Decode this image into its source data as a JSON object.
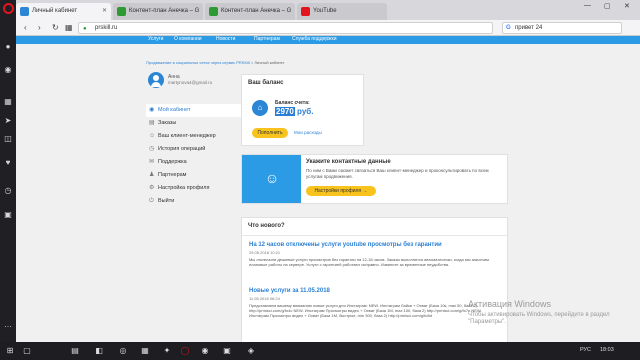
{
  "browser": {
    "tabs": [
      {
        "label": "Личный кабинет",
        "active": true,
        "favicon_color": "#2b86d6"
      },
      {
        "label": "Контент-план Анечка – G",
        "active": false,
        "favicon_color": "#2e9a33"
      },
      {
        "label": "Контент-план Анечка – G",
        "active": false,
        "favicon_color": "#2e9a33"
      },
      {
        "label": "YouTube",
        "active": false,
        "favicon_color": "#e2141d"
      }
    ],
    "url": "prskill.ru",
    "search_value": "привет 24"
  },
  "site_nav": [
    "Услуги",
    "О компании",
    "Новости",
    "Партнерам",
    "Служба поддержки"
  ],
  "breadcrumb": {
    "root": "Продвижение в социальных сетях через сервис PRSKill",
    "current": "Личный кабинет"
  },
  "user": {
    "name": "Анна",
    "email": "martynova4@gmail.ru"
  },
  "menu": [
    {
      "label": "Мой кабинет",
      "icon": "dashboard-icon",
      "glyph": "◉",
      "active": true
    },
    {
      "label": "Заказы",
      "icon": "orders-icon",
      "glyph": "▤",
      "active": false
    },
    {
      "label": "Ваш клиент-менеджер",
      "icon": "manager-icon",
      "glyph": "☺",
      "active": false
    },
    {
      "label": "История операций",
      "icon": "history-icon",
      "glyph": "◷",
      "active": false
    },
    {
      "label": "Поддержка",
      "icon": "support-icon",
      "glyph": "✉",
      "active": false
    },
    {
      "label": "Партнерам",
      "icon": "partners-icon",
      "glyph": "♟",
      "active": false
    },
    {
      "label": "Настройка профиля",
      "icon": "settings-icon",
      "glyph": "⚙",
      "active": false
    },
    {
      "label": "Выйти",
      "icon": "logout-icon",
      "glyph": "⏻",
      "active": false
    }
  ],
  "balance": {
    "title": "Ваш баланс",
    "label": "Баланс счета:",
    "value": "2970",
    "currency": "руб.",
    "pay_label": "Пополнить",
    "expenses_label": "Мои расходы"
  },
  "contact": {
    "title": "Укажите контактные данные",
    "text": "По ним с Вами сможет связаться Ваш клиент-менеджер и проконсультировать по всем услугам продвижения.",
    "button_label": "Настройки профиля →"
  },
  "news": {
    "heading": "Что нового?",
    "items": [
      {
        "title": "На 12 часов отключены услуги youtube просмотры без гарантии",
        "date": "25.05.2018 10:21",
        "text": "Мы отключили дешевые услуги просмотров без гарантии на 12-18 часов. Заказы выполнятся автоматически, когда мы закончим плановые работы на сервере. Услуги с гарантией работают исправно. Извините за временные неудобства."
      },
      {
        "title": "Новые услуги за 11.05.2018",
        "date": "11.05.2018 06:24",
        "text": "Представляем вашему вниманию новые услуги для Инстаграм: NEW. Инстаграм Лайки + Охват (База 10к, max 50, база 2) http://prmisci.com/g/fo4c NEW. Инстаграм Просмотры видео + Охват (База 1М, max 100, база 2) http://prmisci.com/g/fo7n NEW. Инстаграм Просмотры видео + Охват (База 1М, быстрые, min 300, база 2) http://prmisci.com/g/fo8d"
      }
    ]
  },
  "watermark": {
    "title": "Активация Windows",
    "text": "Чтобы активировать Windows, перейдите в раздел \"Параметры\"."
  },
  "taskbar": {
    "lang": "РУС",
    "time": "18:03"
  }
}
